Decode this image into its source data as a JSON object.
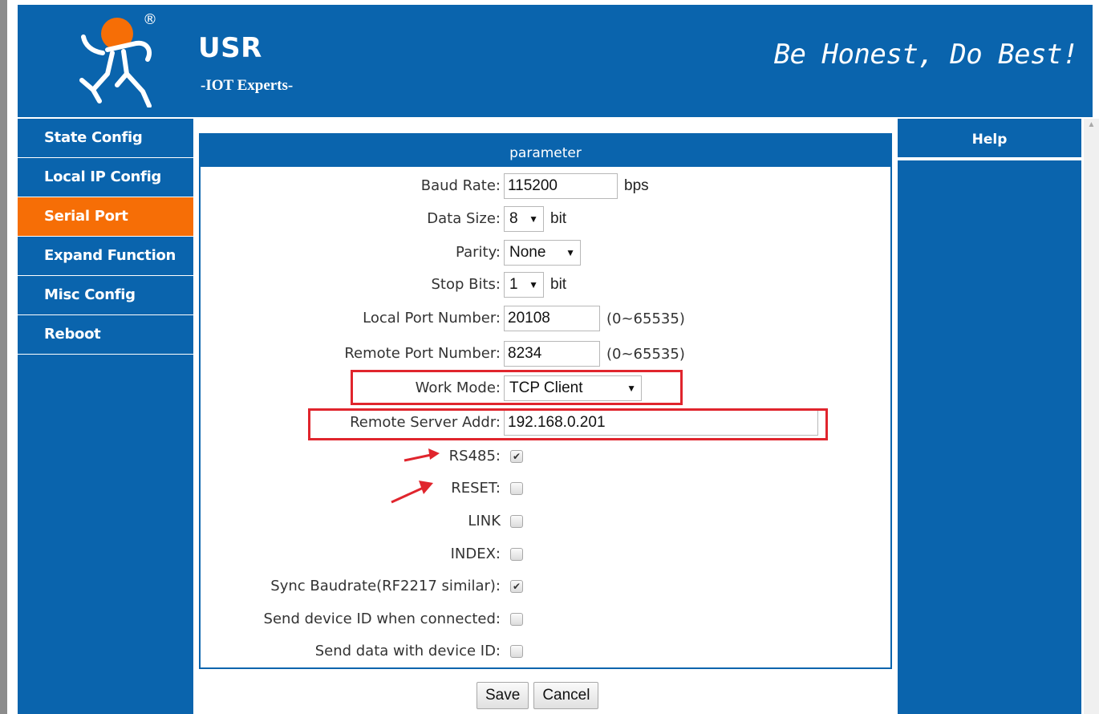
{
  "header": {
    "brand": "USR",
    "subtitle": "-IOT Experts-",
    "slogan": "Be Honest, Do Best!",
    "registered_mark": "®"
  },
  "sidebar": {
    "items": [
      {
        "label": "State Config",
        "active": false
      },
      {
        "label": "Local IP Config",
        "active": false
      },
      {
        "label": "Serial Port",
        "active": true
      },
      {
        "label": "Expand Function",
        "active": false
      },
      {
        "label": "Misc Config",
        "active": false
      },
      {
        "label": "Reboot",
        "active": false
      }
    ]
  },
  "panel": {
    "title": "parameter",
    "baud_rate": {
      "label": "Baud Rate:",
      "value": "115200",
      "unit": "bps"
    },
    "data_size": {
      "label": "Data Size:",
      "value": "8",
      "unit": "bit"
    },
    "parity": {
      "label": "Parity:",
      "value": "None"
    },
    "stop_bits": {
      "label": "Stop Bits:",
      "value": "1",
      "unit": "bit"
    },
    "local_port": {
      "label": "Local Port Number:",
      "value": "20108",
      "range": "(0~65535)"
    },
    "remote_port": {
      "label": "Remote Port Number:",
      "value": "8234",
      "range": "(0~65535)"
    },
    "work_mode": {
      "label": "Work Mode:",
      "value": "TCP Client"
    },
    "remote_addr": {
      "label": "Remote Server Addr:",
      "value": "192.168.0.201"
    },
    "rs485": {
      "label": "RS485:",
      "checked": true
    },
    "reset": {
      "label": "RESET:",
      "checked": false
    },
    "link": {
      "label": "LINK",
      "checked": false
    },
    "index": {
      "label": "INDEX:",
      "checked": false
    },
    "sync_baud": {
      "label": "Sync Baudrate(RF2217 similar):",
      "checked": true
    },
    "send_id_connected": {
      "label": "Send device ID when connected:",
      "checked": false
    },
    "send_data_id": {
      "label": "Send data with device ID:",
      "checked": false
    }
  },
  "buttons": {
    "save": "Save",
    "cancel": "Cancel"
  },
  "help": {
    "title": "Help"
  },
  "glyphs": {
    "dropdown": "▼",
    "check": "✔"
  },
  "colors": {
    "primary": "#0a64ad",
    "active": "#f66e06",
    "highlight": "#e0252d"
  }
}
